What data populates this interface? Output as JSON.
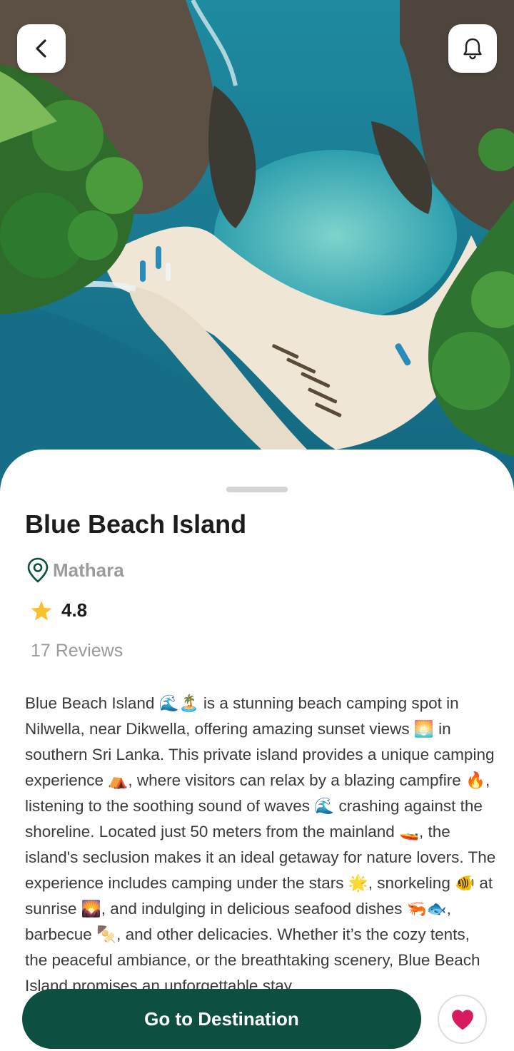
{
  "hero": {
    "image": "aerial-beach-photo",
    "back_icon": "chevron-left-icon",
    "bell_icon": "bell-icon"
  },
  "place": {
    "title": "Blue Beach Island",
    "location": "Mathara",
    "location_icon": "location-pin-icon",
    "rating": "4.8",
    "rating_icon": "star-icon",
    "reviews": "17 Reviews",
    "description": "Blue Beach Island 🌊🏝️ is a stunning beach camping spot in Nilwella, near Dikwella, offering amazing sunset views 🌅 in southern Sri Lanka. This private island provides a unique camping experience ⛺, where visitors can relax by a blazing campfire 🔥, listening to the soothing sound of waves 🌊 crashing against the shoreline. Located just 50 meters from the mainland 🚤, the island's seclusion makes it an ideal getaway for nature lovers. The experience includes camping under the stars 🌟, snorkeling 🐠 at sunrise 🌄, and indulging in delicious seafood dishes 🦐🐟, barbecue 🍢, and other delicacies. Whether it’s the cozy tents, the peaceful ambiance, or the breathtaking scenery, Blue Beach Island promises an unforgettable stay."
  },
  "actions": {
    "go_label": "Go to Destination",
    "favorite_icon": "heart-icon"
  },
  "colors": {
    "primary": "#0d4f40",
    "favorite": "#d81b60",
    "star": "#fbc02d",
    "muted_text": "#9c9c9c"
  }
}
